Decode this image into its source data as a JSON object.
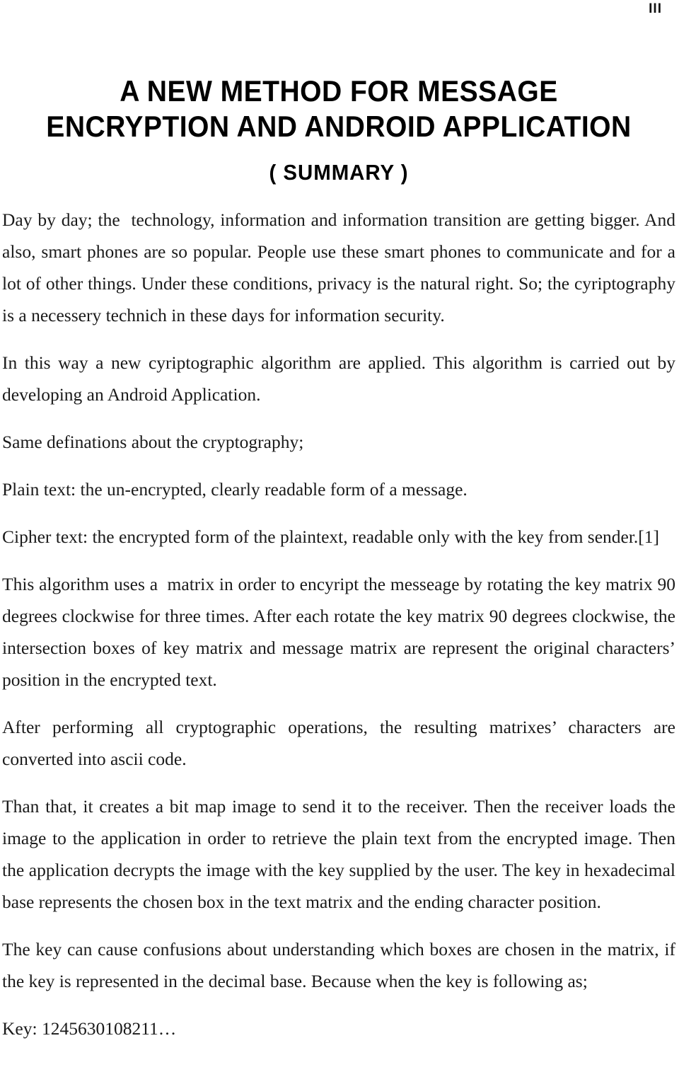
{
  "page": {
    "folio": "III",
    "background_color": "#ffffff",
    "text_color": "#1a1a1a"
  },
  "title": {
    "line1": "A NEW METHOD FOR MESSAGE",
    "line2": "ENCRYPTION AND ANDROID APPLICATION",
    "subtitle": "( SUMMARY )"
  },
  "body": {
    "paragraphs": [
      {
        "id": "intro",
        "justified": true,
        "text": "Day by day; the  technology, information and information transition are getting bigger. And also, smart phones are so popular. People use these smart phones to communicate and for a lot of other things. Under these conditions, privacy is the natural right. So; the cyriptography is a necessery technich in these days for information security."
      },
      {
        "id": "algorithm-applied",
        "justified": true,
        "text": "In this way a new cyriptographic algorithm are applied. This algorithm is carried out by developing an Android Application."
      },
      {
        "id": "definitions-heading",
        "justified": false,
        "text": "Same definations about the cryptography;"
      },
      {
        "id": "plain-text-definition",
        "justified": false,
        "text": "Plain text: the un-encrypted, clearly readable form of a message."
      },
      {
        "id": "cipher-text-definition",
        "justified": false,
        "text": "Cipher text: the encrypted form of the plaintext, readable only with the key from sender.[1]"
      },
      {
        "id": "matrix-rotation",
        "justified": true,
        "text": "This algorithm uses a  matrix in order to encyript the messeage by rotating the key matrix 90 degrees clockwise for three times. After each rotate the key matrix 90 degrees clockwise, the intersection boxes of key matrix and message matrix are represent the original characters’ position in the encrypted text."
      },
      {
        "id": "ascii-conversion",
        "justified": true,
        "text": "After performing all cryptographic operations, the resulting matrixes’ characters are converted into ascii code."
      },
      {
        "id": "bitmap-transmission",
        "justified": true,
        "text": "Than that, it creates a bit map image to send it to the receiver. Then the receiver loads the image to the application in order to retrieve the plain text from the encrypted image. Then the application decrypts the image with the key supplied by the user. The key in hexadecimal base represents the chosen box in the text matrix and the ending character position."
      },
      {
        "id": "key-confusion",
        "justified": true,
        "text": "The key can cause confusions about understanding which boxes are chosen in the matrix, if the key is represented in the decimal base. Because when the key is following as;"
      },
      {
        "id": "key-example",
        "justified": false,
        "text": "Key: 1245630108211…"
      }
    ]
  }
}
